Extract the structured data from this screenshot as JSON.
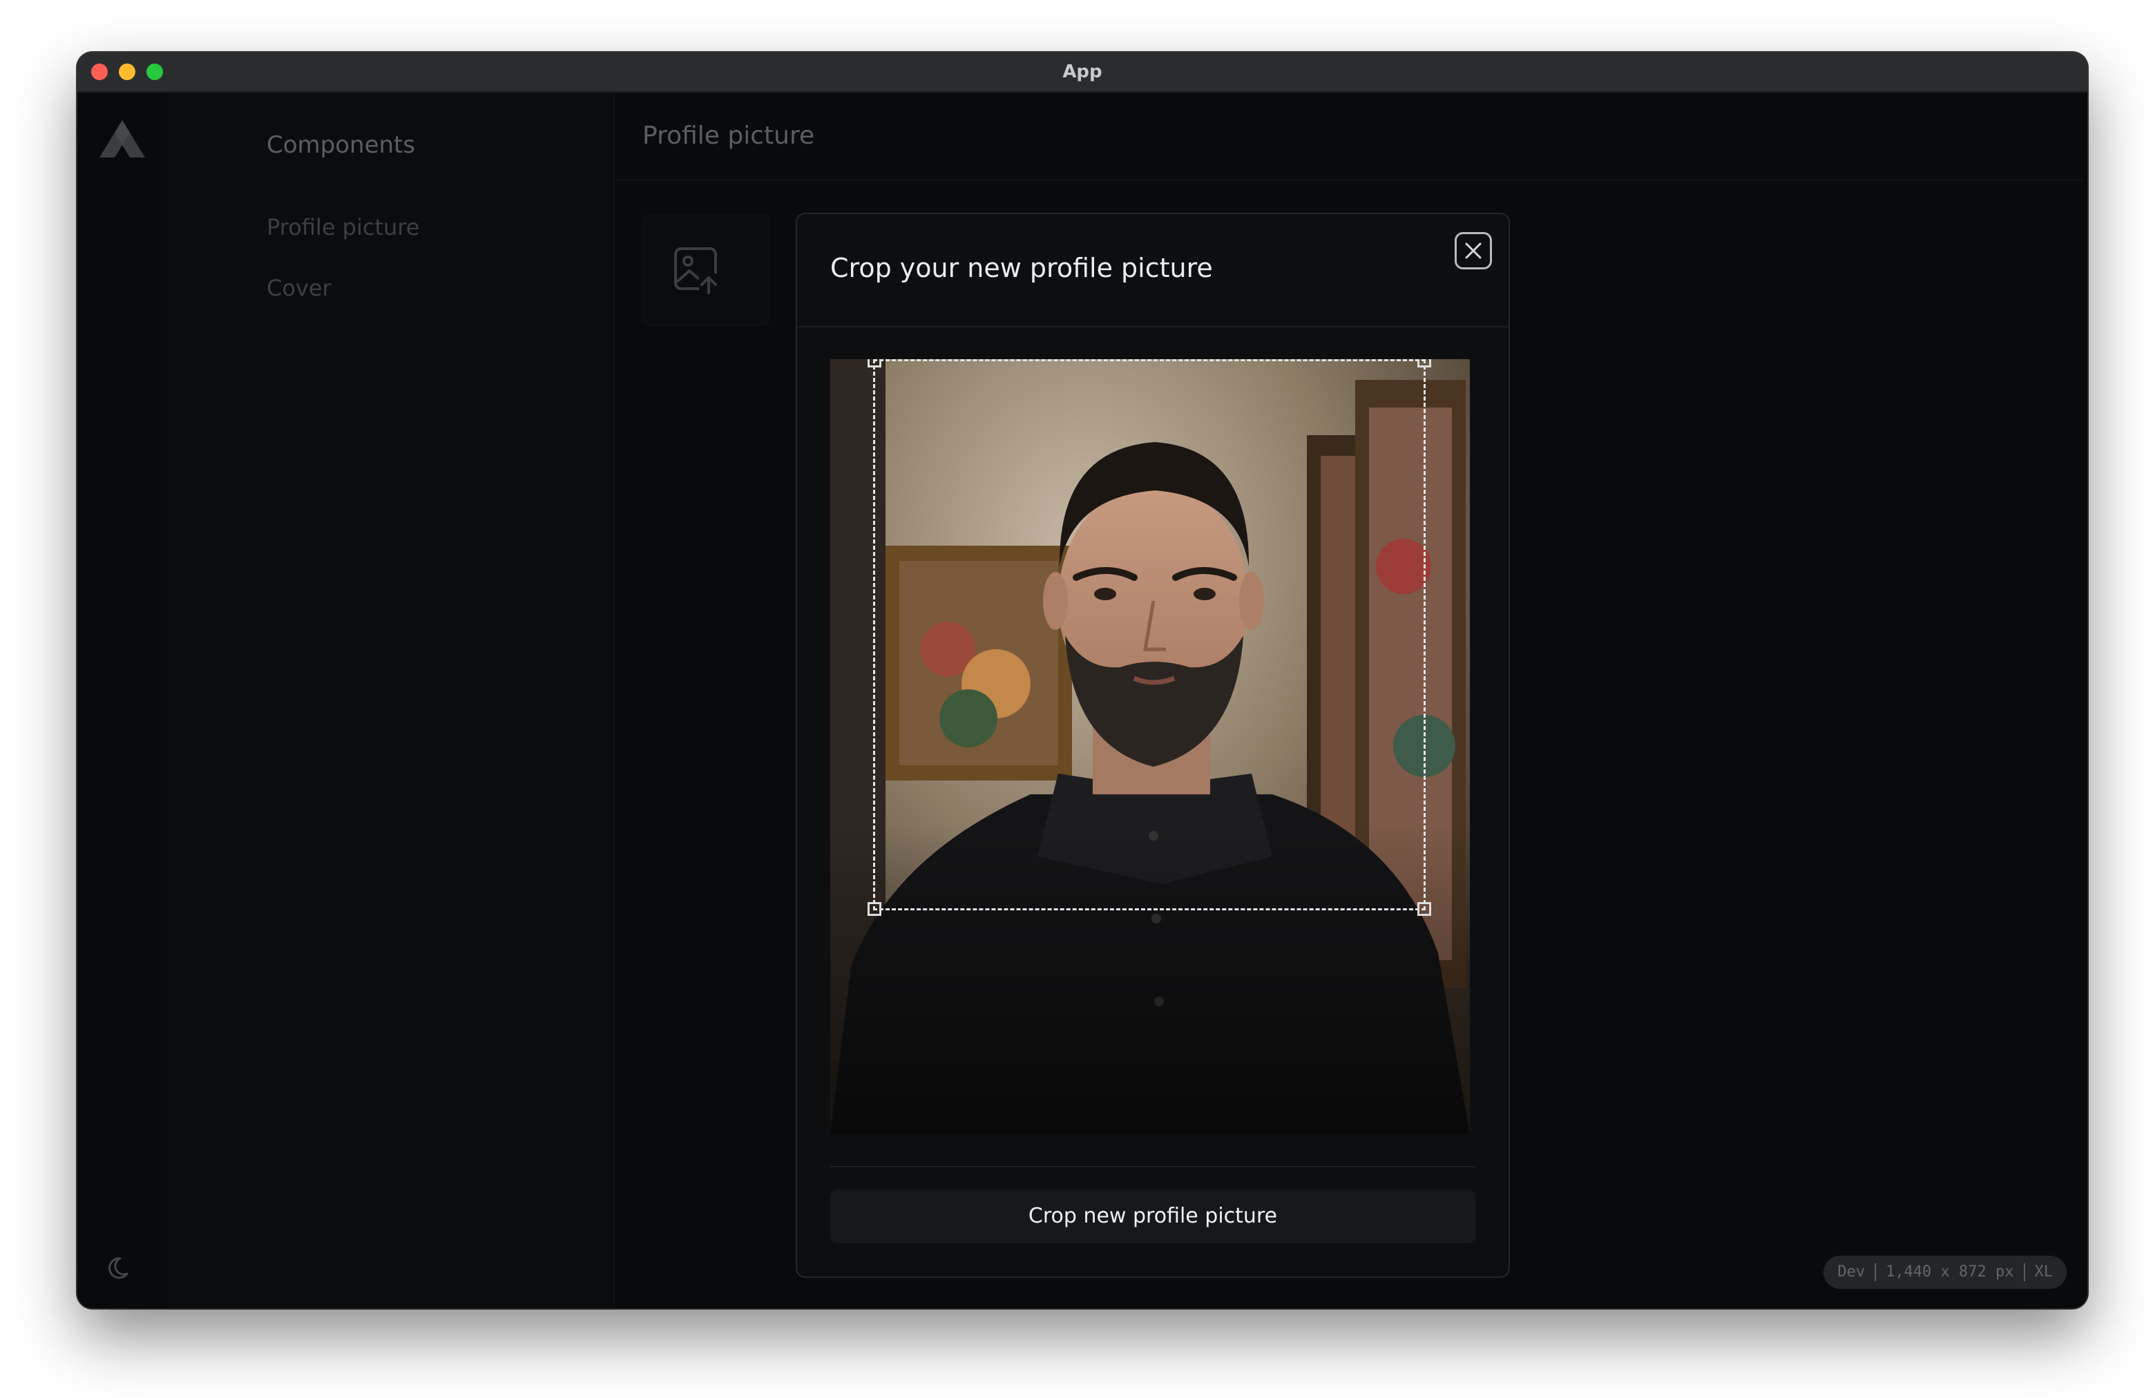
{
  "window": {
    "title": "App"
  },
  "sidebar": {
    "heading": "Components",
    "items": [
      {
        "label": "Profile picture"
      },
      {
        "label": "Cover"
      }
    ]
  },
  "main": {
    "title": "Profile picture"
  },
  "modal": {
    "title": "Crop your new profile picture",
    "button_label": "Crop new profile picture"
  },
  "dev_badge": {
    "env": "Dev",
    "viewport": "1,440 x 872 px",
    "breakpoint": "XL"
  },
  "icons": {
    "logo": "logo-icon",
    "theme": "moon-icon",
    "upload": "image-upload-icon",
    "close": "close-icon"
  }
}
